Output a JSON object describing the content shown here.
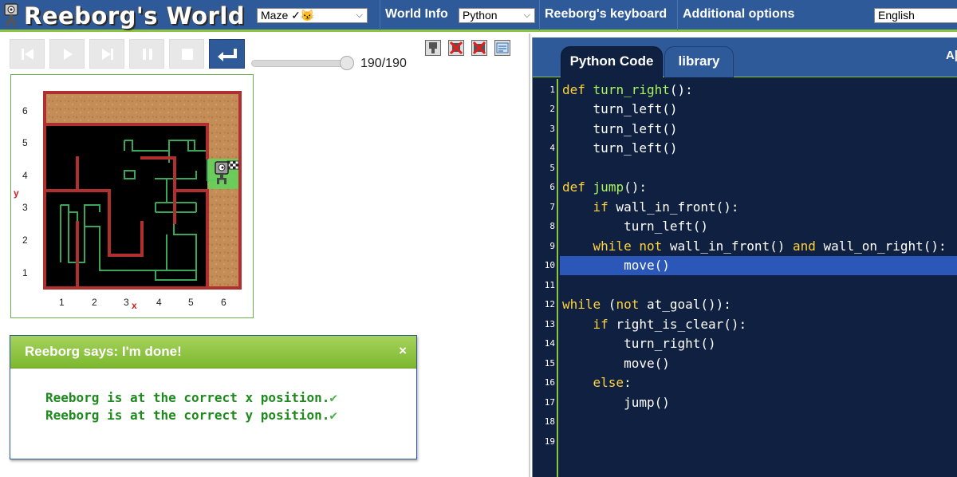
{
  "app": {
    "title": "Reeborg's World",
    "colors": {
      "bar": "#2f5a9a",
      "accent": "#8cc63f",
      "editor_bg": "#102040"
    }
  },
  "topbar": {
    "world_select": "Maze ✓😼",
    "world_info": "World Info",
    "language_select": "Python",
    "keyboard": "Reeborg's keyboard",
    "options": "Additional options",
    "ui_language": "English"
  },
  "controls": {
    "icons": [
      "reload-icon",
      "run-icon",
      "step-icon",
      "pause-icon",
      "stop-icon",
      "return-icon"
    ],
    "step_count": "190/190",
    "progress": 1.0
  },
  "tools": [
    "robot-tool-icon",
    "delete-robot-icon",
    "clear-world-icon",
    "edit-world-icon"
  ],
  "world": {
    "y_label": "y",
    "x_label": "x",
    "x_ticks": [
      "1",
      "2",
      "3",
      "4",
      "5",
      "6"
    ],
    "y_ticks": [
      "6",
      "5",
      "4",
      "3",
      "2",
      "1"
    ],
    "robot": {
      "x": 6,
      "y": 4,
      "icon": "reeborg-robot-icon"
    },
    "goal": {
      "x": 6,
      "y": 4,
      "icon": "checkered-flag-icon"
    }
  },
  "dialog": {
    "title": "Reeborg says: I'm done!",
    "close": "×",
    "lines": [
      "Reeborg is at the correct x position.",
      "Reeborg is at the correct y position."
    ],
    "check": "✔"
  },
  "editor": {
    "tabs": [
      "Python Code",
      "library"
    ],
    "right_label": "A|",
    "highlighted_line": 10,
    "line_numbers": [
      "1",
      "2",
      "3",
      "4",
      "5",
      "6",
      "7",
      "8",
      "9",
      "10",
      "11",
      "12",
      "13",
      "14",
      "15",
      "16",
      "17",
      "18",
      "19"
    ]
  }
}
